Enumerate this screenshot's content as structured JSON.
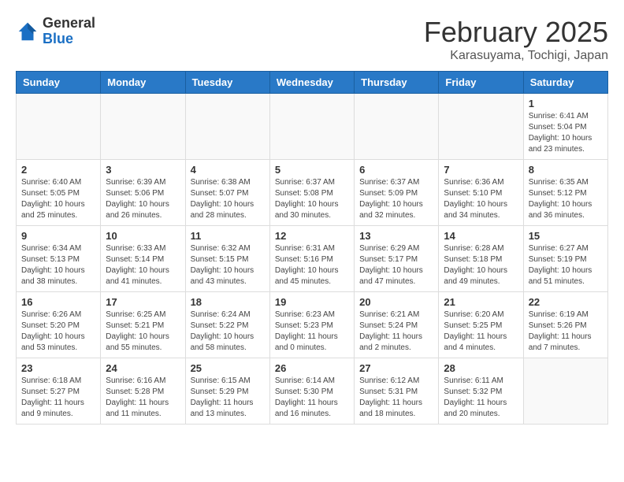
{
  "header": {
    "logo": {
      "general": "General",
      "blue": "Blue"
    },
    "title": "February 2025",
    "location": "Karasuyama, Tochigi, Japan"
  },
  "weekdays": [
    "Sunday",
    "Monday",
    "Tuesday",
    "Wednesday",
    "Thursday",
    "Friday",
    "Saturday"
  ],
  "weeks": [
    [
      {
        "day": "",
        "detail": ""
      },
      {
        "day": "",
        "detail": ""
      },
      {
        "day": "",
        "detail": ""
      },
      {
        "day": "",
        "detail": ""
      },
      {
        "day": "",
        "detail": ""
      },
      {
        "day": "",
        "detail": ""
      },
      {
        "day": "1",
        "detail": "Sunrise: 6:41 AM\nSunset: 5:04 PM\nDaylight: 10 hours and 23 minutes."
      }
    ],
    [
      {
        "day": "2",
        "detail": "Sunrise: 6:40 AM\nSunset: 5:05 PM\nDaylight: 10 hours and 25 minutes."
      },
      {
        "day": "3",
        "detail": "Sunrise: 6:39 AM\nSunset: 5:06 PM\nDaylight: 10 hours and 26 minutes."
      },
      {
        "day": "4",
        "detail": "Sunrise: 6:38 AM\nSunset: 5:07 PM\nDaylight: 10 hours and 28 minutes."
      },
      {
        "day": "5",
        "detail": "Sunrise: 6:37 AM\nSunset: 5:08 PM\nDaylight: 10 hours and 30 minutes."
      },
      {
        "day": "6",
        "detail": "Sunrise: 6:37 AM\nSunset: 5:09 PM\nDaylight: 10 hours and 32 minutes."
      },
      {
        "day": "7",
        "detail": "Sunrise: 6:36 AM\nSunset: 5:10 PM\nDaylight: 10 hours and 34 minutes."
      },
      {
        "day": "8",
        "detail": "Sunrise: 6:35 AM\nSunset: 5:12 PM\nDaylight: 10 hours and 36 minutes."
      }
    ],
    [
      {
        "day": "9",
        "detail": "Sunrise: 6:34 AM\nSunset: 5:13 PM\nDaylight: 10 hours and 38 minutes."
      },
      {
        "day": "10",
        "detail": "Sunrise: 6:33 AM\nSunset: 5:14 PM\nDaylight: 10 hours and 41 minutes."
      },
      {
        "day": "11",
        "detail": "Sunrise: 6:32 AM\nSunset: 5:15 PM\nDaylight: 10 hours and 43 minutes."
      },
      {
        "day": "12",
        "detail": "Sunrise: 6:31 AM\nSunset: 5:16 PM\nDaylight: 10 hours and 45 minutes."
      },
      {
        "day": "13",
        "detail": "Sunrise: 6:29 AM\nSunset: 5:17 PM\nDaylight: 10 hours and 47 minutes."
      },
      {
        "day": "14",
        "detail": "Sunrise: 6:28 AM\nSunset: 5:18 PM\nDaylight: 10 hours and 49 minutes."
      },
      {
        "day": "15",
        "detail": "Sunrise: 6:27 AM\nSunset: 5:19 PM\nDaylight: 10 hours and 51 minutes."
      }
    ],
    [
      {
        "day": "16",
        "detail": "Sunrise: 6:26 AM\nSunset: 5:20 PM\nDaylight: 10 hours and 53 minutes."
      },
      {
        "day": "17",
        "detail": "Sunrise: 6:25 AM\nSunset: 5:21 PM\nDaylight: 10 hours and 55 minutes."
      },
      {
        "day": "18",
        "detail": "Sunrise: 6:24 AM\nSunset: 5:22 PM\nDaylight: 10 hours and 58 minutes."
      },
      {
        "day": "19",
        "detail": "Sunrise: 6:23 AM\nSunset: 5:23 PM\nDaylight: 11 hours and 0 minutes."
      },
      {
        "day": "20",
        "detail": "Sunrise: 6:21 AM\nSunset: 5:24 PM\nDaylight: 11 hours and 2 minutes."
      },
      {
        "day": "21",
        "detail": "Sunrise: 6:20 AM\nSunset: 5:25 PM\nDaylight: 11 hours and 4 minutes."
      },
      {
        "day": "22",
        "detail": "Sunrise: 6:19 AM\nSunset: 5:26 PM\nDaylight: 11 hours and 7 minutes."
      }
    ],
    [
      {
        "day": "23",
        "detail": "Sunrise: 6:18 AM\nSunset: 5:27 PM\nDaylight: 11 hours and 9 minutes."
      },
      {
        "day": "24",
        "detail": "Sunrise: 6:16 AM\nSunset: 5:28 PM\nDaylight: 11 hours and 11 minutes."
      },
      {
        "day": "25",
        "detail": "Sunrise: 6:15 AM\nSunset: 5:29 PM\nDaylight: 11 hours and 13 minutes."
      },
      {
        "day": "26",
        "detail": "Sunrise: 6:14 AM\nSunset: 5:30 PM\nDaylight: 11 hours and 16 minutes."
      },
      {
        "day": "27",
        "detail": "Sunrise: 6:12 AM\nSunset: 5:31 PM\nDaylight: 11 hours and 18 minutes."
      },
      {
        "day": "28",
        "detail": "Sunrise: 6:11 AM\nSunset: 5:32 PM\nDaylight: 11 hours and 20 minutes."
      },
      {
        "day": "",
        "detail": ""
      }
    ]
  ]
}
